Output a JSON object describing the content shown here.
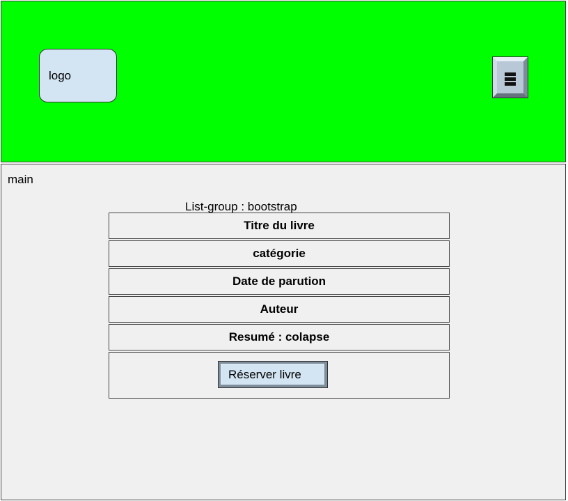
{
  "header": {
    "logo_label": "logo",
    "menu_icon": "menu-icon",
    "background_color": "#00ff00"
  },
  "main": {
    "label": "main",
    "list_group_caption": "List-group : bootstrap",
    "items": [
      {
        "label": "Titre du livre"
      },
      {
        "label": "catégorie"
      },
      {
        "label": "Date de parution"
      },
      {
        "label": "Auteur"
      },
      {
        "label": "Resumé : colapse"
      }
    ],
    "reserve_button_label": "Réserver livre"
  }
}
